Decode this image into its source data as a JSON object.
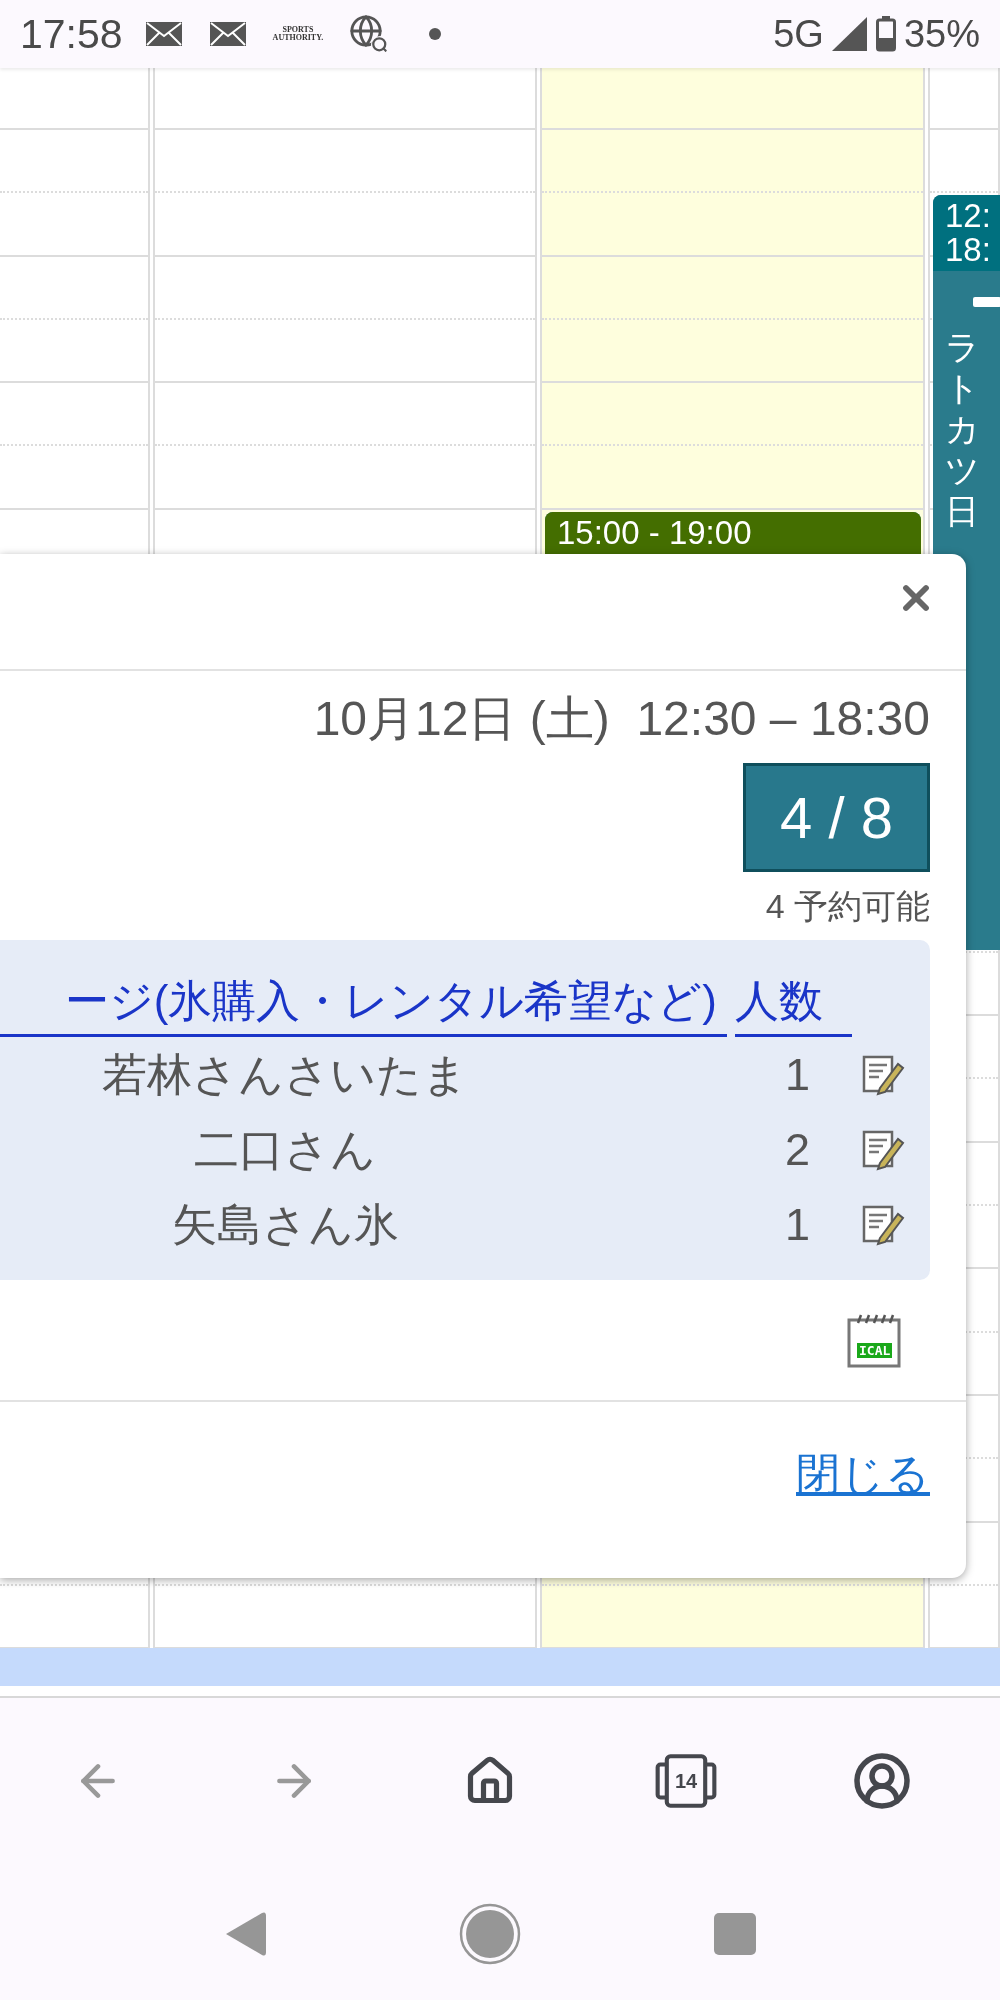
{
  "status_bar": {
    "time": "17:58",
    "notifications": [
      {
        "kind": "mail"
      },
      {
        "kind": "mail"
      },
      {
        "kind": "logo",
        "lines": [
          "SPORTS",
          "AUTHORITY."
        ]
      },
      {
        "kind": "globe"
      },
      {
        "kind": "dot"
      }
    ],
    "network": "5G",
    "battery": "35%"
  },
  "calendar": {
    "columns": [
      {
        "today": false
      },
      {
        "today": false
      },
      {
        "today": true,
        "events": [
          {
            "time_lines": [
              "15:00 - 19:00"
            ],
            "color": "#446e00"
          }
        ]
      },
      {
        "today": false,
        "events": [
          {
            "time_lines": [
              "12:",
              "18:"
            ],
            "body_lines": [
              "ラ",
              "ト",
              "カ",
              "ツ",
              "日"
            ],
            "color": "#00707f"
          }
        ]
      }
    ]
  },
  "dialog": {
    "datetime": "10月12日 (土)  12:30 – 18:30",
    "capacity": "4 / 8",
    "availability": "4 予約可能",
    "table": {
      "columns": [
        "ージ(氷購入・レンタル希望など)",
        "人数"
      ],
      "rows": [
        {
          "name": "若林さんさいたま",
          "count": "1"
        },
        {
          "name": "二口さん",
          "count": "2"
        },
        {
          "name": "矢島さん氷",
          "count": "1"
        }
      ]
    },
    "ical_label": "ICAL",
    "close_link": "閉じる"
  },
  "browser_nav": [
    {
      "kind": "back",
      "disabled": true
    },
    {
      "kind": "forward",
      "disabled": true
    },
    {
      "kind": "home",
      "disabled": false
    },
    {
      "kind": "tabs",
      "count": "14",
      "disabled": false
    },
    {
      "kind": "account",
      "disabled": false
    }
  ],
  "system_nav": [
    {
      "kind": "back"
    },
    {
      "kind": "home"
    },
    {
      "kind": "recents"
    }
  ]
}
